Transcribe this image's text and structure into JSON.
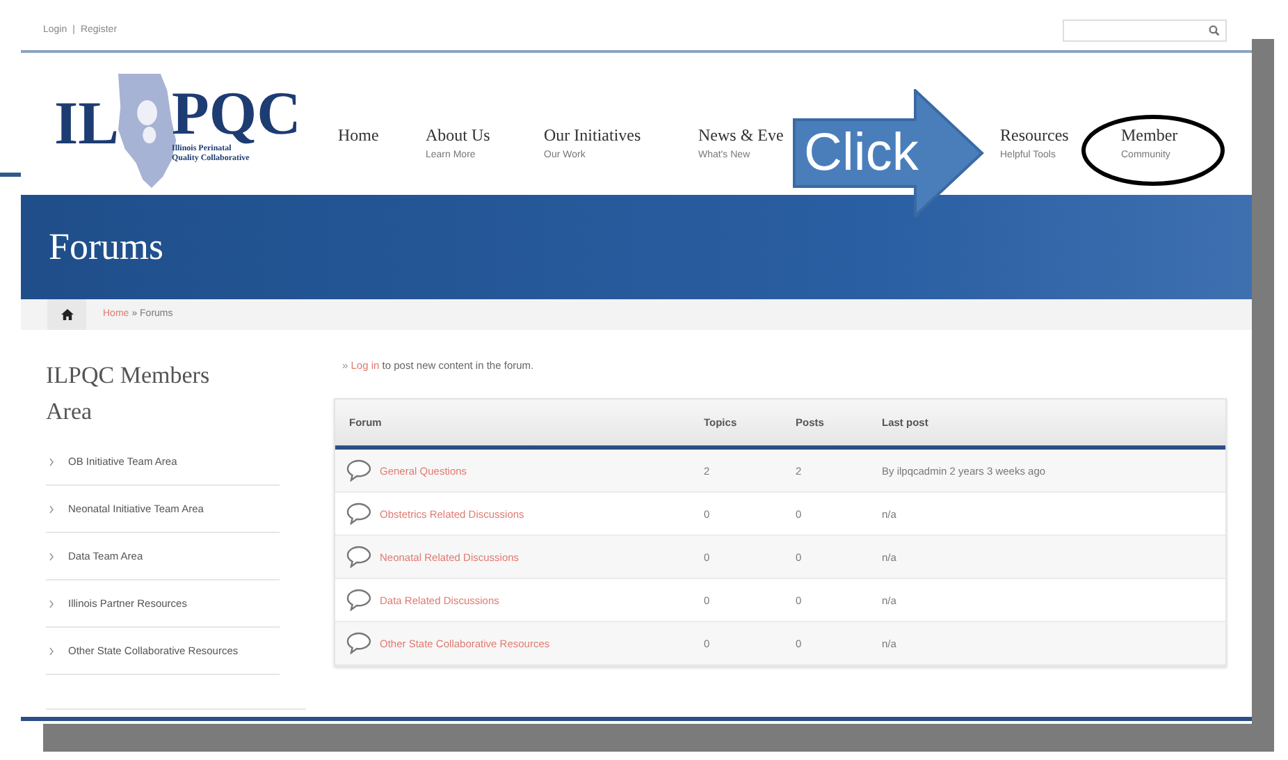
{
  "top_bar": {
    "login": "Login",
    "separator": "|",
    "register": "Register"
  },
  "logo": {
    "left": "IL",
    "right": "PQC",
    "tagline_1": "Illinois Perinatal",
    "tagline_2": "Quality Collaborative"
  },
  "nav": [
    {
      "title": "Home"
    },
    {
      "title": "About Us",
      "subtitle": "Learn More"
    },
    {
      "title": "Our Initiatives",
      "subtitle": "Our Work"
    },
    {
      "title": "News & Eve",
      "subtitle": "What's New"
    },
    {
      "title": "Resources",
      "subtitle": "Helpful Tools"
    },
    {
      "title": "Member",
      "subtitle": "Community",
      "circled": true
    }
  ],
  "callout": {
    "text": "Click"
  },
  "banner": {
    "title": "Forums"
  },
  "breadcrumb": {
    "home": "Home",
    "rest": "» Forums"
  },
  "sidebar": {
    "title": "ILPQC Members Area",
    "items": [
      "OB Initiative Team Area",
      "Neonatal Initiative Team Area",
      "Data Team Area",
      "Illinois Partner Resources",
      "Other State Collaborative Resources"
    ]
  },
  "notice": {
    "bullet": "»",
    "link": "Log in",
    "text": "to post new content in the forum."
  },
  "table": {
    "columns": [
      "Forum",
      "Topics",
      "Posts",
      "Last post"
    ],
    "rows": [
      {
        "forum": "General Questions",
        "topics": "2",
        "posts": "2",
        "last_post": "By ilpqcadmin 2 years 3 weeks ago"
      },
      {
        "forum": "Obstetrics Related Discussions",
        "topics": "0",
        "posts": "0",
        "last_post": "n/a"
      },
      {
        "forum": "Neonatal Related Discussions",
        "topics": "0",
        "posts": "0",
        "last_post": "n/a"
      },
      {
        "forum": "Data Related Discussions",
        "topics": "0",
        "posts": "0",
        "last_post": "n/a"
      },
      {
        "forum": "Other State Collaborative Resources",
        "topics": "0",
        "posts": "0",
        "last_post": "n/a"
      }
    ]
  }
}
